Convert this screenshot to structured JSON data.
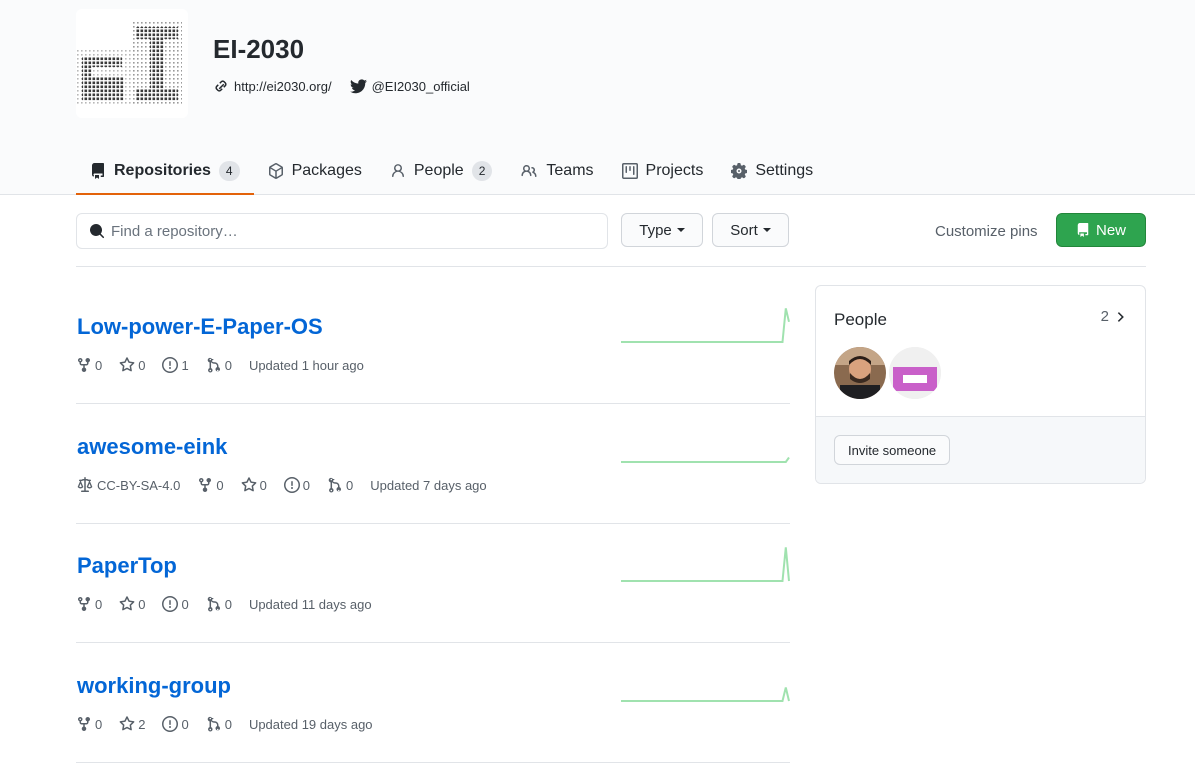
{
  "org": {
    "name": "EI-2030",
    "website": "http://ei2030.org/",
    "twitter": "@EI2030_official",
    "logo_text": "eI"
  },
  "tabs": [
    {
      "label": "Repositories",
      "count": "4",
      "icon": "repo-icon"
    },
    {
      "label": "Packages",
      "icon": "package-icon"
    },
    {
      "label": "People",
      "count": "2",
      "icon": "person-icon"
    },
    {
      "label": "Teams",
      "icon": "people-icon"
    },
    {
      "label": "Projects",
      "icon": "project-icon"
    },
    {
      "label": "Settings",
      "icon": "gear-icon"
    }
  ],
  "filters": {
    "search_placeholder": "Find a repository…",
    "type_label": "Type",
    "sort_label": "Sort",
    "customize_label": "Customize pins",
    "new_label": "New"
  },
  "repos": [
    {
      "name": "Low-power-E-Paper-OS",
      "license": "",
      "forks": "0",
      "stars": "0",
      "issues": "1",
      "prs": "0",
      "updated": "Updated 1 hour ago",
      "activity": [
        0,
        0,
        0,
        0,
        0,
        0,
        0,
        0,
        0,
        0,
        0,
        0,
        0,
        0,
        0,
        0,
        0,
        0,
        0,
        0,
        0,
        0,
        0,
        0,
        0,
        0,
        0,
        0,
        0,
        0,
        0,
        0,
        0,
        0,
        0,
        0,
        0,
        0,
        0,
        0,
        0,
        0,
        0,
        0,
        0,
        0,
        0,
        0,
        0,
        0,
        0,
        30,
        18
      ]
    },
    {
      "name": "awesome-eink",
      "license": "CC-BY-SA-4.0",
      "forks": "0",
      "stars": "0",
      "issues": "0",
      "prs": "0",
      "updated": "Updated 7 days ago",
      "activity": [
        0,
        0,
        0,
        0,
        0,
        0,
        0,
        0,
        0,
        0,
        0,
        0,
        0,
        0,
        0,
        0,
        0,
        0,
        0,
        0,
        0,
        0,
        0,
        0,
        0,
        0,
        0,
        0,
        0,
        0,
        0,
        0,
        0,
        0,
        0,
        0,
        0,
        0,
        0,
        0,
        0,
        0,
        0,
        0,
        0,
        0,
        0,
        0,
        0,
        0,
        0,
        0,
        4
      ]
    },
    {
      "name": "PaperTop",
      "license": "",
      "forks": "0",
      "stars": "0",
      "issues": "0",
      "prs": "0",
      "updated": "Updated 11 days ago",
      "activity": [
        0,
        0,
        0,
        0,
        0,
        0,
        0,
        0,
        0,
        0,
        0,
        0,
        0,
        0,
        0,
        0,
        0,
        0,
        0,
        0,
        0,
        0,
        0,
        0,
        0,
        0,
        0,
        0,
        0,
        0,
        0,
        0,
        0,
        0,
        0,
        0,
        0,
        0,
        0,
        0,
        0,
        0,
        0,
        0,
        0,
        0,
        0,
        0,
        0,
        0,
        0,
        30,
        0
      ]
    },
    {
      "name": "working-group",
      "license": "",
      "forks": "0",
      "stars": "2",
      "issues": "0",
      "prs": "0",
      "updated": "Updated 19 days ago",
      "activity": [
        0,
        0,
        0,
        0,
        0,
        0,
        0,
        0,
        0,
        0,
        0,
        0,
        0,
        0,
        0,
        0,
        0,
        0,
        0,
        0,
        0,
        0,
        0,
        0,
        0,
        0,
        0,
        0,
        0,
        0,
        0,
        0,
        0,
        0,
        0,
        0,
        0,
        0,
        0,
        0,
        0,
        0,
        0,
        0,
        0,
        0,
        0,
        0,
        0,
        0,
        0,
        12,
        0
      ]
    }
  ],
  "people": {
    "title": "People",
    "count": "2",
    "invite_label": "Invite someone"
  },
  "colors": {
    "accent_tab": "#e36209",
    "link": "#0366d6",
    "new_button": "#2ea44f",
    "sparkline": "#2cbe4e"
  }
}
